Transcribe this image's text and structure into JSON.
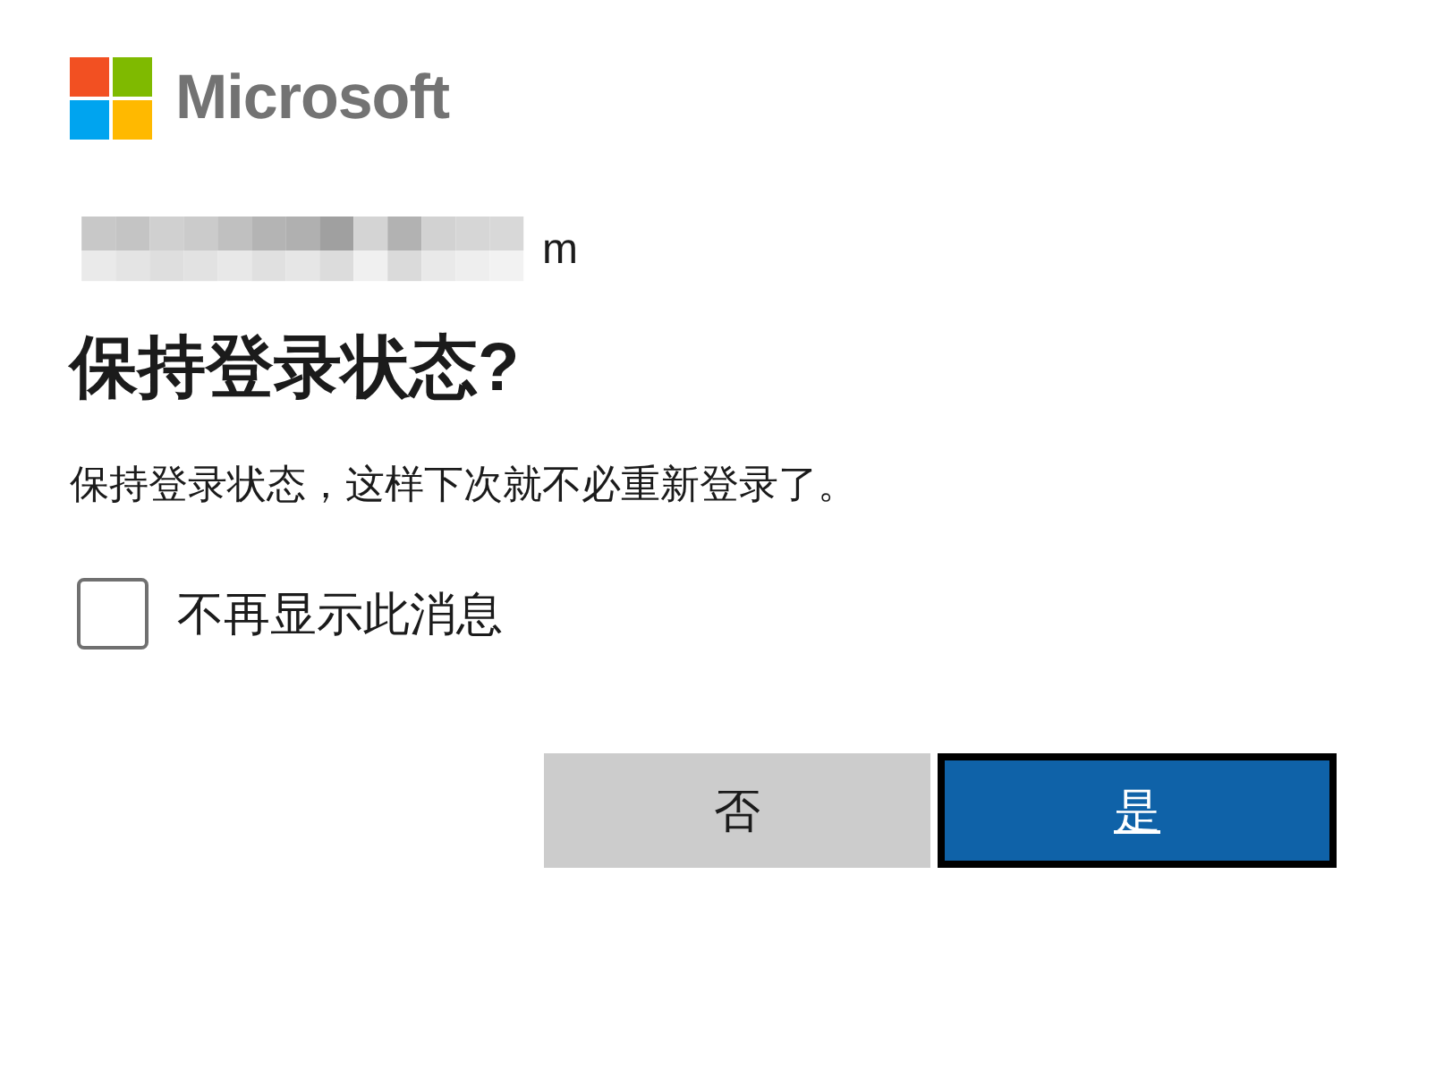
{
  "brand": {
    "name": "Microsoft"
  },
  "account": {
    "shown_tail": "m"
  },
  "title": "保持登录状态?",
  "message": "保持登录状态，这样下次就不必重新登录了。",
  "checkbox": {
    "label": "不再显示此消息",
    "checked": false
  },
  "buttons": [
    {
      "label": "否",
      "kind": "secondary"
    },
    {
      "label": "是",
      "kind": "primary"
    }
  ]
}
